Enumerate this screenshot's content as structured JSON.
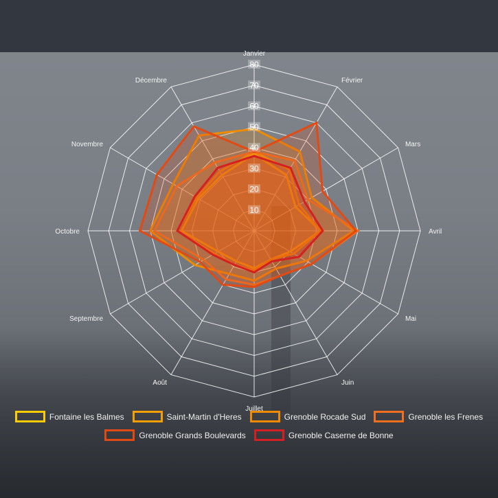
{
  "chart_data": {
    "type": "radar",
    "title": "",
    "categories": [
      "Janvier",
      "Février",
      "Mars",
      "Avril",
      "Mai",
      "Juin",
      "Juillet",
      "Août",
      "Septembre",
      "Octobre",
      "Novembre",
      "Décembre"
    ],
    "radial_ticks": [
      10,
      20,
      30,
      40,
      50,
      60,
      70,
      80
    ],
    "rmax": 80,
    "series": [
      {
        "name": "Fontaine les Balmes",
        "color": "#ffcc00",
        "values": [
          37,
          31,
          23,
          32,
          20,
          16,
          18,
          17,
          20,
          35,
          31,
          31
        ]
      },
      {
        "name": "Saint-Martin d'Heres",
        "color": "#f5a000",
        "values": [
          38,
          34,
          25,
          32,
          22,
          16,
          19,
          19,
          22,
          37,
          32,
          33
        ]
      },
      {
        "name": "Grenoble Rocade Sud",
        "color": "#f08a00",
        "values": [
          49,
          44,
          32,
          48,
          29,
          21,
          24,
          24,
          33,
          50,
          45,
          53
        ]
      },
      {
        "name": "Grenoble les Frenes",
        "color": "#f07020",
        "values": [
          38,
          39,
          30,
          50,
          32,
          25,
          26,
          27,
          28,
          48,
          43,
          38
        ]
      },
      {
        "name": "Grenoble Grands Boulevards",
        "color": "#e24a14",
        "values": [
          38,
          60,
          38,
          49,
          32,
          25,
          27,
          30,
          30,
          55,
          54,
          58
        ]
      },
      {
        "name": "Grenoble Caserne de Bonne",
        "color": "#d42020",
        "values": [
          36,
          35,
          28,
          33,
          25,
          17,
          20,
          19,
          23,
          37,
          33,
          35
        ]
      }
    ],
    "grid": true,
    "legend_position": "bottom"
  }
}
